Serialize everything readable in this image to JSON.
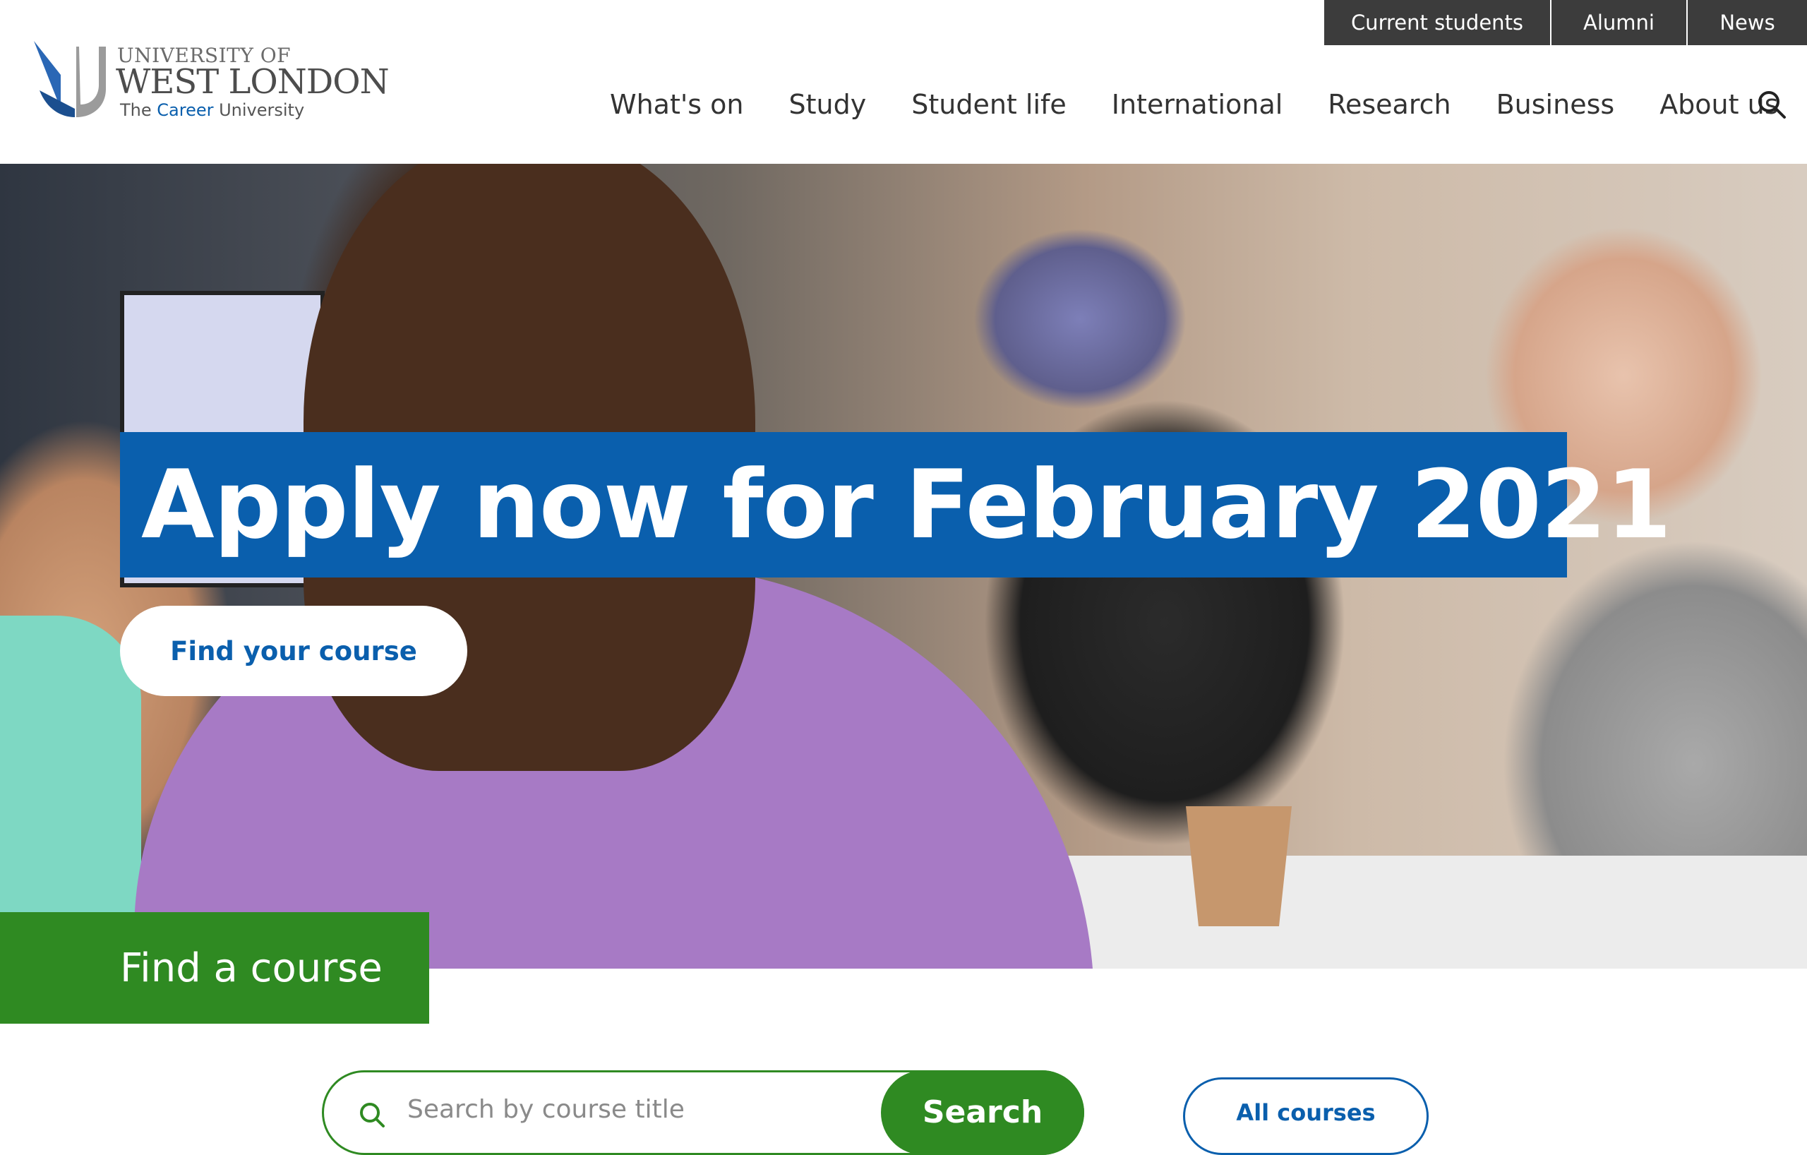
{
  "utility_nav": {
    "items": [
      "Current students",
      "Alumni",
      "News"
    ]
  },
  "logo": {
    "line1": "UNIVERSITY OF",
    "line2": "WEST LONDON",
    "tagline_prefix": "The ",
    "tagline_highlight": "Career",
    "tagline_suffix": " University"
  },
  "main_nav": {
    "items": [
      "What's on",
      "Study",
      "Student life",
      "International",
      "Research",
      "Business",
      "About us"
    ],
    "search_icon": "search-icon"
  },
  "hero": {
    "title": "Apply now for February 2021",
    "cta_label": "Find your course"
  },
  "find_course": {
    "tab_label": "Find a course",
    "search_placeholder": "Search by course title",
    "search_button": "Search",
    "all_courses_button": "All courses"
  },
  "colors": {
    "brand_blue": "#0a5fad",
    "brand_green": "#2f8a22",
    "utility_bg": "#3c3c3c"
  }
}
